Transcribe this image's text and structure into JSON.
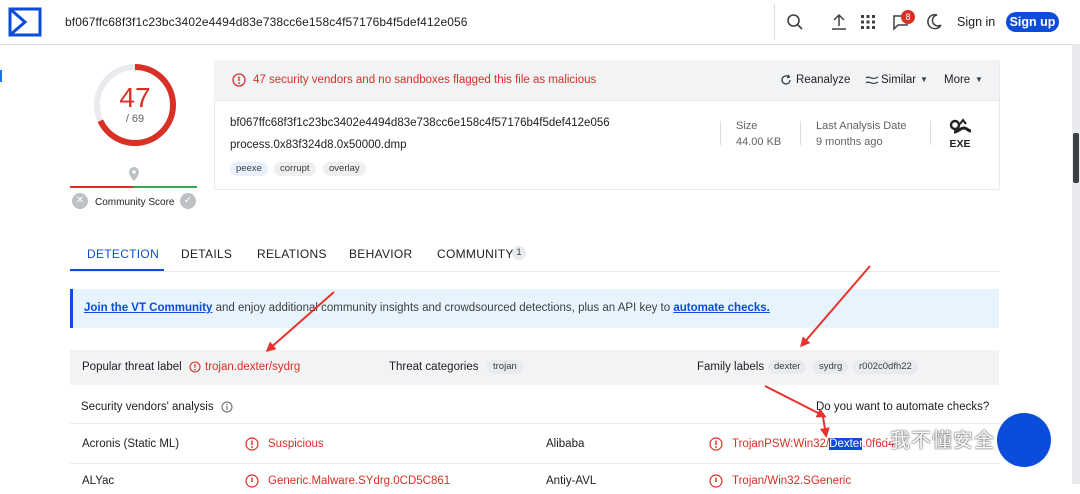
{
  "topbar": {
    "search_value": "bf067ffc68f3f1c23bc3402e4494d83e738cc6e158c4f57176b4f5def412e056",
    "notification_count": "8",
    "signin_label": "Sign in",
    "signup_label": "Sign up",
    "icons": [
      "virustotal-logo",
      "search-icon",
      "upload-icon",
      "apps-grid-icon",
      "chat-icon",
      "dark-mode-icon"
    ]
  },
  "score": {
    "detections": "47",
    "total": "/ 69",
    "community_label": "Community Score",
    "detection_fraction": 0.681
  },
  "summary": {
    "alert": "47 security vendors and no sandboxes flagged this file as malicious",
    "actions": {
      "reanalyze": "Reanalyze",
      "similar": "Similar",
      "more": "More"
    },
    "hash": "bf067ffc68f3f1c23bc3402e4494d83e738cc6e158c4f57176b4f5def412e056",
    "filename": "process.0x83f324d8.0x50000.dmp",
    "tags": [
      "peexe",
      "corrupt",
      "overlay"
    ],
    "size_label": "Size",
    "size_value": "44.00 KB",
    "last_analysis_label": "Last Analysis Date",
    "last_analysis_value": "9 months ago",
    "file_type": "EXE"
  },
  "tabs": [
    {
      "label": "DETECTION",
      "active": true
    },
    {
      "label": "DETAILS",
      "active": false
    },
    {
      "label": "RELATIONS",
      "active": false
    },
    {
      "label": "BEHAVIOR",
      "active": false
    },
    {
      "label": "COMMUNITY",
      "active": false,
      "count": "1"
    }
  ],
  "banner": {
    "link1": "Join the VT Community",
    "text": " and enjoy additional community insights and crowdsourced detections, plus an API key to ",
    "link2": "automate checks."
  },
  "labels": {
    "popular_label": "Popular threat label",
    "popular_value": "trojan.dexter/sydrg",
    "categories_label": "Threat categories",
    "categories": [
      "trojan"
    ],
    "family_label": "Family labels",
    "families": [
      "dexter",
      "sydrg",
      "r002c0dfh22"
    ]
  },
  "vendors": {
    "title": "Security vendors' analysis",
    "automate_question": "Do you want to automate checks?",
    "rows": [
      {
        "left_name": "Acronis (Static ML)",
        "left_result": "Suspicious",
        "right_name": "Alibaba",
        "right_result_pre": "TrojanPSW:Win32/",
        "right_result_hl": "Dexter",
        "right_result_post": ".0f6d4"
      },
      {
        "left_name": "ALYac",
        "left_result": "Generic.Malware.SYdrg.0CD5C861",
        "right_name": "Antiy-AVL",
        "right_result_pre": "Trojan/Win32.SGeneric",
        "right_result_hl": "",
        "right_result_post": ""
      }
    ]
  },
  "watermark": {
    "text": "我不懂安全"
  },
  "colors": {
    "accent": "#0b4dda",
    "danger": "#d93025",
    "safe": "#34a853",
    "annotation_arrow": "#e8322b"
  }
}
